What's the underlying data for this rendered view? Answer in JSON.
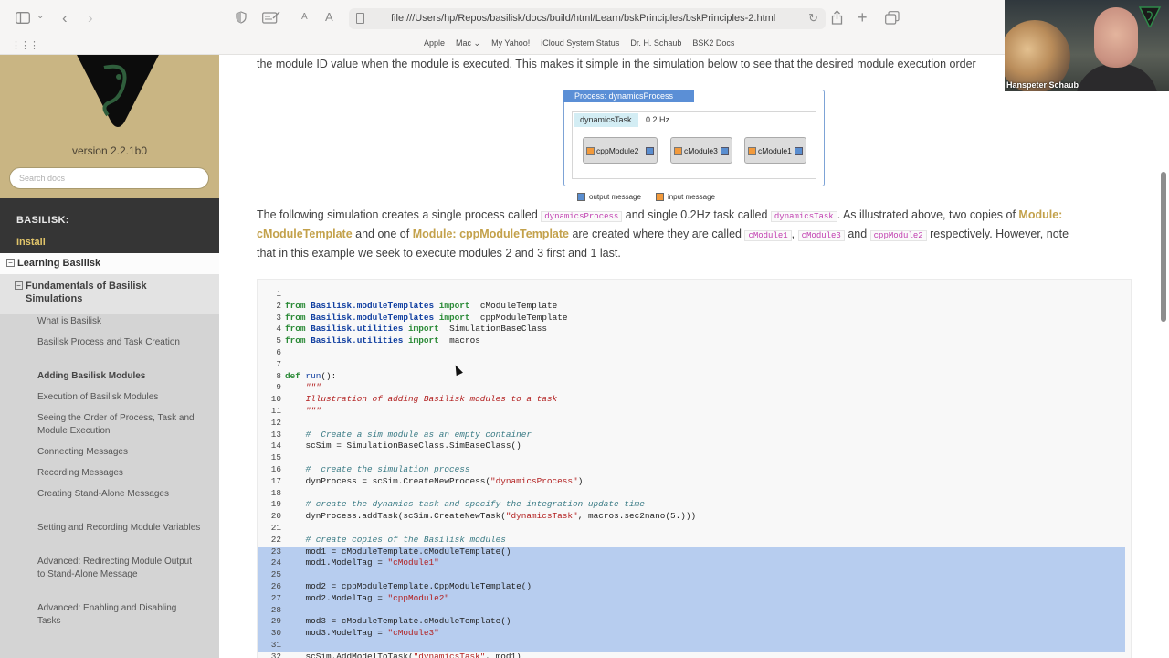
{
  "browser": {
    "url": "file:///Users/hp/Repos/basilisk/docs/build/html/Learn/bskPrinciples/bskPrinciples-2.html",
    "favorites": [
      "Apple",
      "Mac ⌄",
      "My Yahoo!",
      "iCloud System Status",
      "Dr. H. Schaub",
      "BSK2 Docs"
    ],
    "text_small": "A",
    "text_large": "A"
  },
  "sidebar": {
    "version": "version 2.2.1b0",
    "search_placeholder": "Search docs",
    "caption": "BASILISK:",
    "install": "Install",
    "learning": "Learning Basilisk",
    "expand_symbol": "−",
    "fundamentals": "Fundamentals of Basilisk Simulations",
    "items": [
      "What is Basilisk",
      "Basilisk Process and Task Creation",
      "Adding Basilisk Modules",
      "Execution of Basilisk Modules",
      "Seeing the Order of Process, Task and Module Execution",
      "Connecting Messages",
      "Recording Messages",
      "Creating Stand-Alone Messages",
      "Setting and Recording Module Variables",
      "Advanced: Redirecting Module Output to Stand-Alone Message",
      "Advanced: Enabling and Disabling Tasks"
    ],
    "current_index": 2
  },
  "content": {
    "intro_line": "the module ID value when the module is executed. This makes it simple in the simulation below to see that the desired module execution order",
    "diagram": {
      "process_title": "Process: dynamicsProcess",
      "task_name": "dynamicsTask",
      "task_rate": "0.2 Hz",
      "modules": [
        "cppModule2",
        "cModule3",
        "cModule1"
      ],
      "legend_output": "output message",
      "legend_input": "input message",
      "colors": {
        "input": "#f29a3c",
        "output": "#5a8ed0"
      }
    },
    "para": {
      "t1": "The following simulation creates a single process called ",
      "c1": "dynamicsProcess",
      "t2": " and single 0.2Hz task called ",
      "c2": "dynamicsTask",
      "t3": ". As illustrated above, two copies of ",
      "r1a": "Module:",
      "r1b": "cModuleTemplate",
      "t4": " and one of ",
      "r2": "Module: cppModuleTemplate",
      "t5": " are created where they are called ",
      "c3": "cModule1",
      "sep": ", ",
      "c4": "cModule3",
      "and": " and ",
      "c5": "cppModule2",
      "t6": " respectively. However, note",
      "t7": "that in this example we seek to execute modules 2 and 3 first and 1 last."
    }
  },
  "code": {
    "lines": [
      {
        "n": "1",
        "parts": []
      },
      {
        "n": "2",
        "parts": [
          [
            "kw",
            "from "
          ],
          [
            "mod-n",
            "Basilisk.moduleTemplates"
          ],
          [
            "kw",
            " import"
          ],
          [
            "",
            "  cModuleTemplate"
          ]
        ]
      },
      {
        "n": "3",
        "parts": [
          [
            "kw",
            "from "
          ],
          [
            "mod-n",
            "Basilisk.moduleTemplates"
          ],
          [
            "kw",
            " import"
          ],
          [
            "",
            "  cppModuleTemplate"
          ]
        ]
      },
      {
        "n": "4",
        "parts": [
          [
            "kw",
            "from "
          ],
          [
            "mod-n",
            "Basilisk.utilities"
          ],
          [
            "kw",
            " import"
          ],
          [
            "",
            "  SimulationBaseClass"
          ]
        ]
      },
      {
        "n": "5",
        "parts": [
          [
            "kw",
            "from "
          ],
          [
            "mod-n",
            "Basilisk.utilities"
          ],
          [
            "kw",
            " import"
          ],
          [
            "",
            "  macros"
          ]
        ]
      },
      {
        "n": "6",
        "parts": []
      },
      {
        "n": "7",
        "parts": []
      },
      {
        "n": "8",
        "parts": [
          [
            "kw",
            "def "
          ],
          [
            "fn",
            "run"
          ],
          [
            "",
            "():"
          ]
        ]
      },
      {
        "n": "9",
        "parts": [
          [
            "ds",
            "    \"\"\""
          ]
        ]
      },
      {
        "n": "10",
        "parts": [
          [
            "ds",
            "    Illustration of adding Basilisk modules to a task"
          ]
        ]
      },
      {
        "n": "11",
        "parts": [
          [
            "ds",
            "    \"\"\""
          ]
        ]
      },
      {
        "n": "12",
        "parts": []
      },
      {
        "n": "13",
        "parts": [
          [
            "cm",
            "    #  Create a sim module as an empty container"
          ]
        ]
      },
      {
        "n": "14",
        "parts": [
          [
            "",
            "    scSim = SimulationBaseClass.SimBaseClass()"
          ]
        ]
      },
      {
        "n": "15",
        "parts": []
      },
      {
        "n": "16",
        "parts": [
          [
            "cm",
            "    #  create the simulation process"
          ]
        ]
      },
      {
        "n": "17",
        "parts": [
          [
            "",
            "    dynProcess = scSim.CreateNewProcess("
          ],
          [
            "st",
            "\"dynamicsProcess\""
          ],
          [
            "",
            ")"
          ]
        ]
      },
      {
        "n": "18",
        "parts": []
      },
      {
        "n": "19",
        "parts": [
          [
            "cm",
            "    # create the dynamics task and specify the integration update time"
          ]
        ]
      },
      {
        "n": "20",
        "parts": [
          [
            "",
            "    dynProcess.addTask(scSim.CreateNewTask("
          ],
          [
            "st",
            "\"dynamicsTask\""
          ],
          [
            "",
            ", macros.sec2nano(5.)))"
          ]
        ]
      },
      {
        "n": "21",
        "parts": []
      },
      {
        "n": "22",
        "parts": [
          [
            "cm",
            "    # create copies of the Basilisk modules"
          ]
        ]
      },
      {
        "n": "23",
        "parts": [
          [
            "",
            "    mod1 = cModuleTemplate.cModuleTemplate()"
          ]
        ]
      },
      {
        "n": "24",
        "parts": [
          [
            "",
            "    mod1.ModelTag = "
          ],
          [
            "st",
            "\"cModule1\""
          ]
        ]
      },
      {
        "n": "25",
        "parts": []
      },
      {
        "n": "26",
        "parts": [
          [
            "",
            "    mod2 = cppModuleTemplate.CppModuleTemplate()"
          ]
        ]
      },
      {
        "n": "27",
        "parts": [
          [
            "",
            "    mod2.ModelTag = "
          ],
          [
            "st",
            "\"cppModule2\""
          ]
        ]
      },
      {
        "n": "28",
        "parts": []
      },
      {
        "n": "29",
        "parts": [
          [
            "",
            "    mod3 = cModuleTemplate.cModuleTemplate()"
          ]
        ]
      },
      {
        "n": "30",
        "parts": [
          [
            "",
            "    mod3.ModelTag = "
          ],
          [
            "st",
            "\"cModule3\""
          ]
        ]
      },
      {
        "n": "31",
        "parts": []
      },
      {
        "n": "32",
        "parts": [
          [
            "",
            "    scSim.AddModelToTask("
          ],
          [
            "st",
            "\"dynamicsTask\""
          ],
          [
            "",
            ", mod1)"
          ]
        ]
      }
    ],
    "highlight_from": 23,
    "highlight_to": 31
  },
  "webcam": {
    "name": "Hanspeter Schaub"
  }
}
